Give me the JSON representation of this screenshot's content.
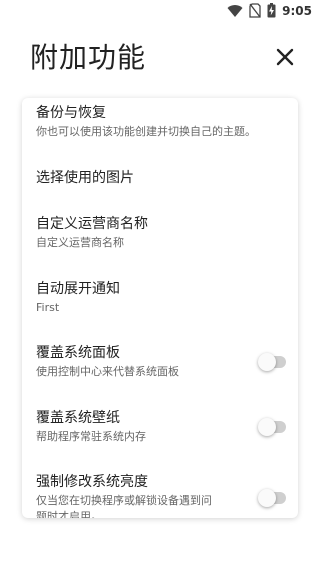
{
  "status_bar": {
    "time": "9:05",
    "icons": [
      "wifi-icon",
      "no-sim-icon",
      "battery-charging-icon"
    ]
  },
  "header": {
    "title": "附加功能",
    "close_icon": "close-icon"
  },
  "settings": {
    "items": [
      {
        "title": "备份与恢复",
        "subtitle": "你也可以使用该功能创建并切换自己的主题。"
      },
      {
        "title": "选择使用的图片",
        "subtitle": ""
      },
      {
        "title": "自定义运营商名称",
        "subtitle": "自定义运营商名称"
      },
      {
        "title": "自动展开通知",
        "subtitle": "First"
      },
      {
        "title": "覆盖系统面板",
        "subtitle": "使用控制中心来代替系统面板",
        "toggle": false
      },
      {
        "title": "覆盖系统壁纸",
        "subtitle": "帮助程序常驻系统内存",
        "toggle": false
      },
      {
        "title": "强制修改系统亮度",
        "subtitle": "仅当您在切换程序或解锁设备遇到问题时才启用。",
        "toggle": false
      }
    ]
  }
}
